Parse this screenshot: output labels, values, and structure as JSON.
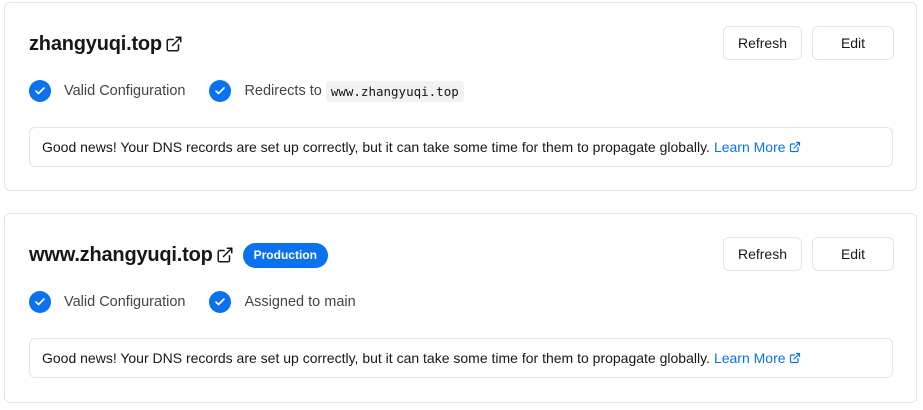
{
  "domains": [
    {
      "name": "zhangyuqi.top",
      "badge": "",
      "refresh_label": "Refresh",
      "edit_label": "Edit",
      "status_valid": "Valid Configuration",
      "status_secondary_prefix": "Redirects to",
      "status_secondary_code": "www.zhangyuqi.top",
      "notice_text": "Good news! Your DNS records are set up correctly, but it can take some time for them to propagate globally.",
      "learn_more": "Learn More"
    },
    {
      "name": "www.zhangyuqi.top",
      "badge": "Production",
      "refresh_label": "Refresh",
      "edit_label": "Edit",
      "status_valid": "Valid Configuration",
      "status_secondary_prefix": "Assigned to main",
      "notice_text": "Good news! Your DNS records are set up correctly, but it can take some time for them to propagate globally.",
      "learn_more": "Learn More"
    }
  ],
  "icons": {
    "external": "external-link-icon",
    "check": "check-circle-icon"
  },
  "colors": {
    "accent": "#0a72ef",
    "border": "#e5e5e5",
    "text": "#171717"
  }
}
